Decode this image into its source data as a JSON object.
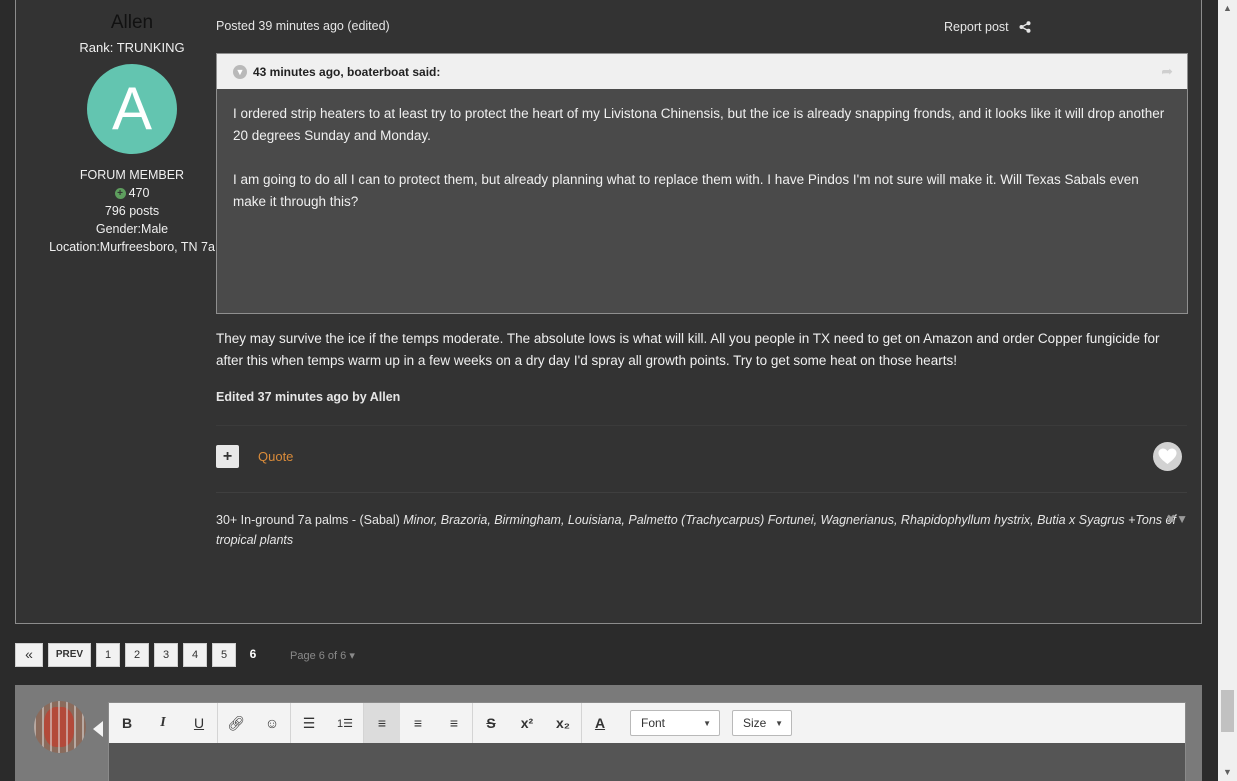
{
  "author": {
    "name": "Allen",
    "rank": "Rank: TRUNKING",
    "avatar_letter": "A",
    "avatar_color": "#63c5b0",
    "group": "FORUM MEMBER",
    "reputation": "470",
    "posts": "796 posts",
    "gender": "Gender:Male",
    "location": "Location:Murfreesboro, TN 7a"
  },
  "post": {
    "meta": "Posted 39 minutes ago (edited)",
    "report": "Report post",
    "quote_header": "43 minutes ago, boaterboat said:",
    "quote_paragraphs": [
      "I ordered strip heaters to at least try to protect the heart of my Livistona Chinensis, but the ice is already snapping fronds, and it looks like it will drop another 20 degrees Sunday and Monday.",
      "I am going to do all I can to protect them, but already planning what to replace them with. I have Pindos I'm not sure will make it. Will Texas Sabals even make it through this?"
    ],
    "reply": "They may survive the ice if the temps moderate.  The absolute lows is what will kill.  All you people in TX need to get on Amazon and order Copper fungicide for after this when temps warm up in a few weeks on a dry day I'd spray all growth points.   Try to get some heat on those hearts!",
    "edited": "Edited 37 minutes ago by Allen",
    "quote_button": "Quote",
    "signature_prefix": "30+ In-ground 7a palms - (Sabal) ",
    "signature_italic": "Minor, Brazoria, Birmingham, Louisiana, Palmetto  (Trachycarpus) Fortunei, Wagnerianus,  Rhapidophyllum hystrix, Butia x Syagrus +Tons of tropical plants"
  },
  "pagination": {
    "first": "«",
    "prev": "PREV",
    "pages": [
      "1",
      "2",
      "3",
      "4",
      "5"
    ],
    "current": "6",
    "page_count": "Page 6 of 6"
  },
  "editor": {
    "font_label": "Font",
    "size_label": "Size"
  },
  "colors": {
    "background": "#2b2b2b",
    "post_bg": "#333333",
    "quote_link": "#d98b3a",
    "reputation": "#5e9e5e"
  }
}
